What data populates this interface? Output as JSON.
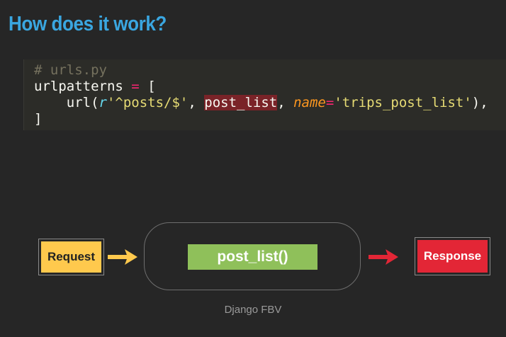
{
  "slide": {
    "title": "How does it work?"
  },
  "code": {
    "comment": "# urls.py",
    "assign_name": "urlpatterns",
    "assign_op": "=",
    "open_bracket": "[",
    "indent": "    ",
    "url_func": "url(",
    "raw_prefix": "r",
    "pattern": "'^posts/$'",
    "sep1": ", ",
    "view_name": "post_list",
    "sep2": ", ",
    "kwarg": "name",
    "kwarg_eq": "=",
    "route_name": "'trips_post_list'",
    "close_call": "),",
    "close_bracket": "]"
  },
  "diagram": {
    "request_label": "Request",
    "function_label": "post_list()",
    "response_label": "Response",
    "caption": "Django FBV",
    "colors": {
      "request": "#ffc94d",
      "function": "#8fc05a",
      "response": "#e32636",
      "arrow_in": "#ffc94d",
      "arrow_out": "#e32636"
    }
  }
}
